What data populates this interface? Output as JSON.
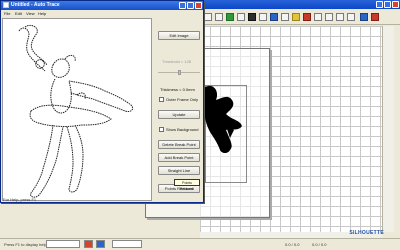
{
  "trace_window": {
    "title": "Untitled - Auto Trace",
    "menu": [
      "File",
      "Edit",
      "View",
      "Help"
    ],
    "status": "For Help, press F1"
  },
  "panel": {
    "edit_image": "Edit Image",
    "threshold_label": "Threshold = 128",
    "threshold_value": 0.5,
    "thickness_label": "Thickness = 0.0mm",
    "outer_frame_only": "Outer Frame Only",
    "update": "Update",
    "show_background": "Show Background",
    "delete_break_point": "Delete Break Point",
    "add_break_point": "Add Break Point",
    "straight_line": "Straight Line",
    "points_reduced": "Points Reduced",
    "tooltip": "Points Reduced"
  },
  "background_app": {
    "status": "Press F1 to display help information.",
    "coords_1": "0.0 / 0.0",
    "coords_2": "0.0 / 0.0",
    "brand": "SILHOUETTE"
  },
  "icons": {
    "toolbar": [
      "grid-icon",
      "pointer-icon",
      "node-icon",
      "hand-icon",
      "eraser-icon",
      "text-icon",
      "line-icon",
      "curve-icon",
      "fill-icon",
      "color-icon",
      "zoom-icon",
      "rotate-icon",
      "ruler-icon",
      "blade-icon",
      "print-icon",
      "cut-icon"
    ]
  },
  "colors": {
    "title_bar": "#1850c8",
    "window_bg": "#ece9d8",
    "close_button": "#d6452a"
  }
}
